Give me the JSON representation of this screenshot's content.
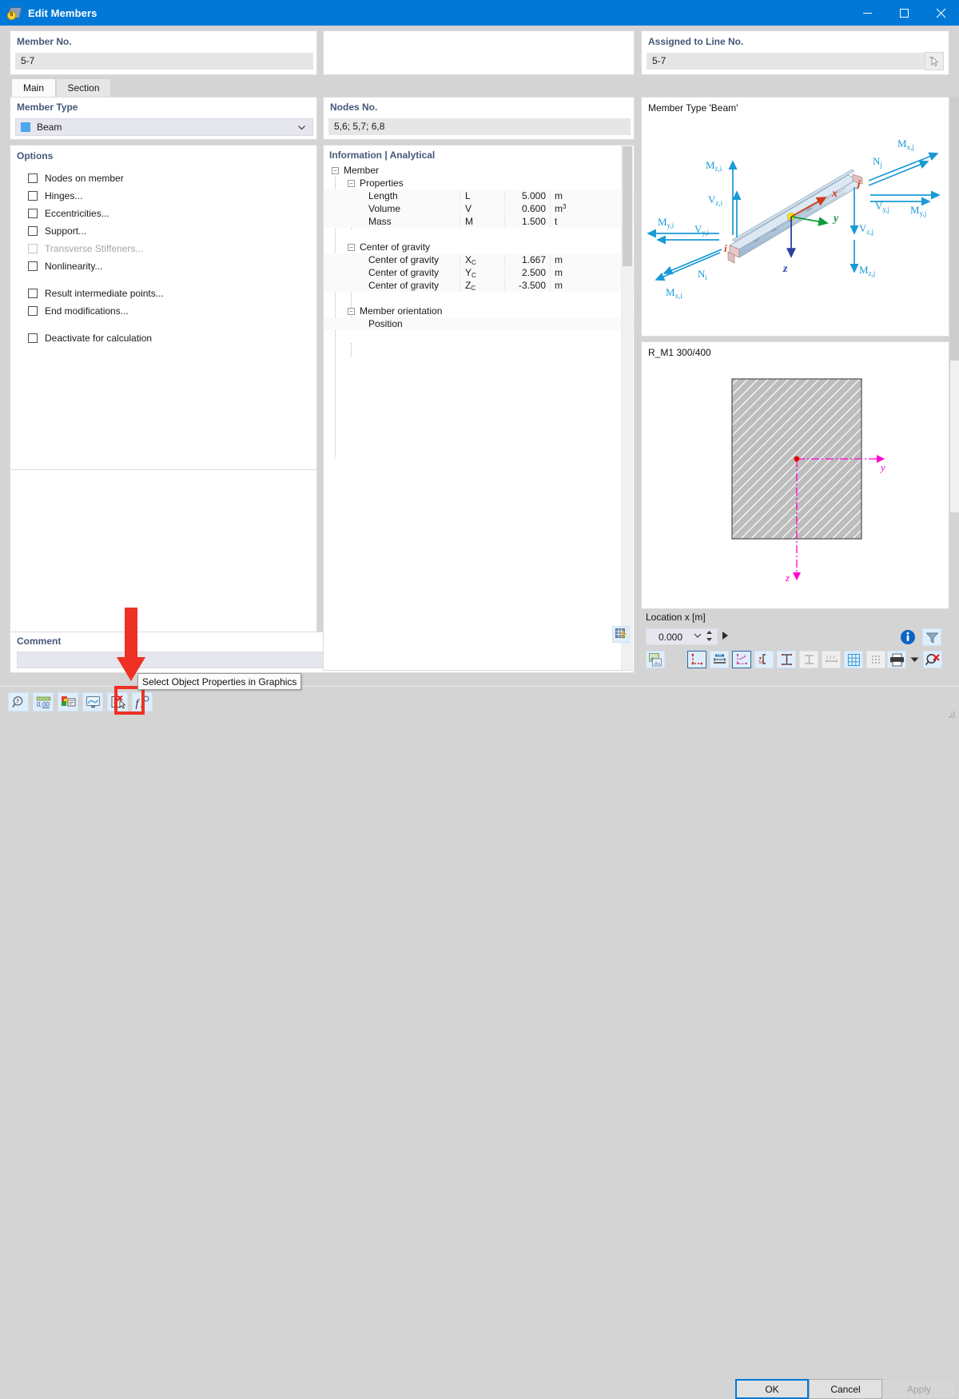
{
  "window": {
    "title": "Edit Members",
    "icon": "members-icon",
    "minimize_label": "Minimize",
    "maximize_label": "Maximize",
    "close_label": "Close"
  },
  "header": {
    "member_no": {
      "label": "Member No.",
      "value": "5-7"
    },
    "assigned_line": {
      "label": "Assigned to Line No.",
      "value": "5-7",
      "pick_icon": "pick-cursor-icon"
    }
  },
  "tabs": [
    {
      "id": "main",
      "label": "Main",
      "active": true
    },
    {
      "id": "section",
      "label": "Section",
      "active": false
    }
  ],
  "left": {
    "member_type": {
      "label": "Member Type",
      "value": "Beam",
      "swatch_color": "#4da6f0"
    },
    "options": {
      "label": "Options",
      "items": [
        {
          "label": "Nodes on member",
          "checked": false,
          "enabled": true
        },
        {
          "label": "Hinges...",
          "checked": false,
          "enabled": true
        },
        {
          "label": "Eccentricities...",
          "checked": false,
          "enabled": true
        },
        {
          "label": "Support...",
          "checked": false,
          "enabled": true
        },
        {
          "label": "Transverse Stiffeners...",
          "checked": false,
          "enabled": false
        },
        {
          "label": "Nonlinearity...",
          "checked": false,
          "enabled": true
        },
        {
          "label": "Result intermediate points...",
          "checked": false,
          "enabled": true
        },
        {
          "label": "End modifications...",
          "checked": false,
          "enabled": true
        },
        {
          "label": "Deactivate for calculation",
          "checked": false,
          "enabled": true
        }
      ]
    }
  },
  "middle": {
    "nodes": {
      "label": "Nodes No.",
      "value": "5,6; 5,7; 6,8"
    },
    "information": {
      "title": "Information | Analytical",
      "root": "Member",
      "groups": [
        {
          "name": "Properties",
          "rows": [
            {
              "name": "Length",
              "symbol": "L",
              "value": "5.000",
              "unit": "m"
            },
            {
              "name": "Volume",
              "symbol": "V",
              "value": "0.600",
              "unit": "m³"
            },
            {
              "name": "Mass",
              "symbol": "M",
              "value": "1.500",
              "unit": "t"
            }
          ]
        },
        {
          "name": "Center of gravity",
          "rows": [
            {
              "name": "Center of gravity",
              "symbol": "Xc",
              "value": "1.667",
              "unit": "m"
            },
            {
              "name": "Center of gravity",
              "symbol": "Yc",
              "value": "2.500",
              "unit": "m"
            },
            {
              "name": "Center of gravity",
              "symbol": "Zc",
              "value": "-3.500",
              "unit": "m"
            }
          ]
        },
        {
          "name": "Member orientation",
          "rows": [
            {
              "name": "Position",
              "symbol": "",
              "value": "",
              "unit": ""
            }
          ]
        }
      ]
    },
    "toolbar": {
      "grid_button_icon": "table-lightning-icon"
    }
  },
  "right": {
    "beam_graphic": {
      "caption": "Member Type 'Beam'",
      "node_start": "i",
      "node_end": "j",
      "axes": [
        "x",
        "y",
        "z"
      ],
      "forces": [
        "M<sub>z,i</sub>",
        "V<sub>z,i</sub>",
        "M<sub>y,i</sub>",
        "V<sub>y,i</sub>",
        "N<sub>i</sub>",
        "M<sub>x,i</sub>",
        "M<sub>x,j</sub>",
        "N<sub>j</sub>",
        "V<sub>y,j</sub>",
        "M<sub>y,j</sub>",
        "V<sub>z,j</sub>",
        "M<sub>z,j</sub>"
      ],
      "arrow_color": "#1a9ad6"
    },
    "section_graphic": {
      "caption": "R_M1 300/400",
      "axis_y": "y",
      "axis_z": "z",
      "hatch_color": "#bdbdbd",
      "axis_color": "#ff00d0"
    },
    "location": {
      "label": "Location x [m]",
      "value": "0.000"
    },
    "top_buttons": [
      {
        "name": "info",
        "icon": "info-icon"
      },
      {
        "name": "filter",
        "icon": "funnel-icon"
      }
    ],
    "toolbar_buttons": [
      {
        "name": "render",
        "icon": "image-render-icon"
      },
      {
        "name": "section-points",
        "icon": "section-points-icon",
        "selected": true
      },
      {
        "name": "dimensions",
        "icon": "dimension-icon",
        "selected": false
      },
      {
        "name": "local-axes",
        "icon": "local-axes-icon",
        "selected": true
      },
      {
        "name": "shear-center",
        "icon": "shear-center-icon",
        "selected": false
      },
      {
        "name": "stress-points",
        "icon": "stress-points-icon",
        "selected": false
      },
      {
        "name": "parts",
        "icon": "parts-icon",
        "disabled": true
      },
      {
        "name": "numbering",
        "icon": "numbering-icon",
        "disabled": true
      },
      {
        "name": "grid",
        "icon": "grid-icon",
        "selected": false
      },
      {
        "name": "dots",
        "icon": "dots-icon",
        "disabled": true
      },
      {
        "name": "print",
        "icon": "printer-icon"
      },
      {
        "name": "print-dropdown",
        "icon": "caret-down-icon"
      },
      {
        "name": "zoom-reset",
        "icon": "zoom-cancel-icon"
      }
    ]
  },
  "comment": {
    "label": "Comment",
    "value": "",
    "copy_icon": "copy-icon"
  },
  "bottom_toolbar": [
    {
      "name": "help",
      "icon": "help-magnifier-icon"
    },
    {
      "name": "units",
      "icon": "units-icon"
    },
    {
      "name": "display-properties",
      "icon": "display-properties-icon"
    },
    {
      "name": "view-mode",
      "icon": "view-mode-icon"
    },
    {
      "name": "select-object-properties",
      "icon": "select-object-properties-icon",
      "highlighted": true
    },
    {
      "name": "formula",
      "icon": "formula-icon"
    }
  ],
  "tooltip": {
    "text": "Select Object Properties in Graphics"
  },
  "dialog_buttons": {
    "ok": "OK",
    "cancel": "Cancel",
    "apply": "Apply",
    "apply_enabled": false
  },
  "colors": {
    "title_bar": "#0078d7",
    "accent": "#0078d7",
    "dialog_bg": "#d4d4d4",
    "group_label": "#45597a",
    "highlight_red": "#ee3124"
  }
}
